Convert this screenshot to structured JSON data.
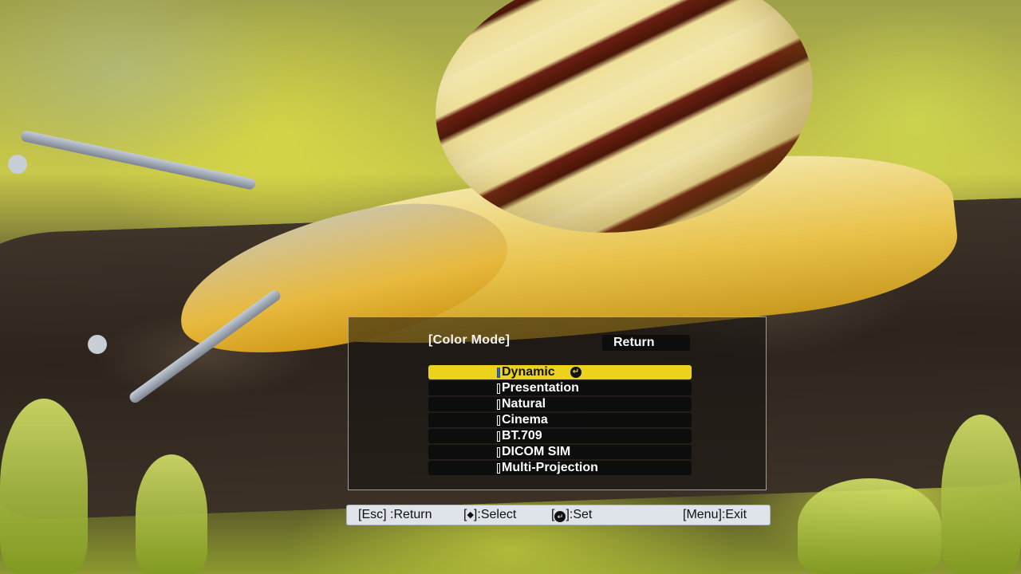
{
  "menu": {
    "title": "[Color Mode]",
    "return_label": "Return",
    "items": [
      {
        "label": "Dynamic",
        "selected": true
      },
      {
        "label": "Presentation"
      },
      {
        "label": "Natural"
      },
      {
        "label": "Cinema"
      },
      {
        "label": "BT.709"
      },
      {
        "label": "DICOM SIM"
      },
      {
        "label": "Multi-Projection"
      }
    ]
  },
  "helpbar": {
    "esc_key": "[Esc]",
    "esc_action": ":Return",
    "select_open": "[",
    "select_icon": "updown-arrows-icon",
    "select_close": "]:Select",
    "set_open": "[",
    "set_icon": "enter-icon",
    "set_close": "]:Set",
    "exit": "[Menu]:Exit"
  },
  "colors": {
    "selected_item": "#ecd11d",
    "item_background": "#0d0d0d",
    "helpbar_background": "#dfe3ea"
  }
}
